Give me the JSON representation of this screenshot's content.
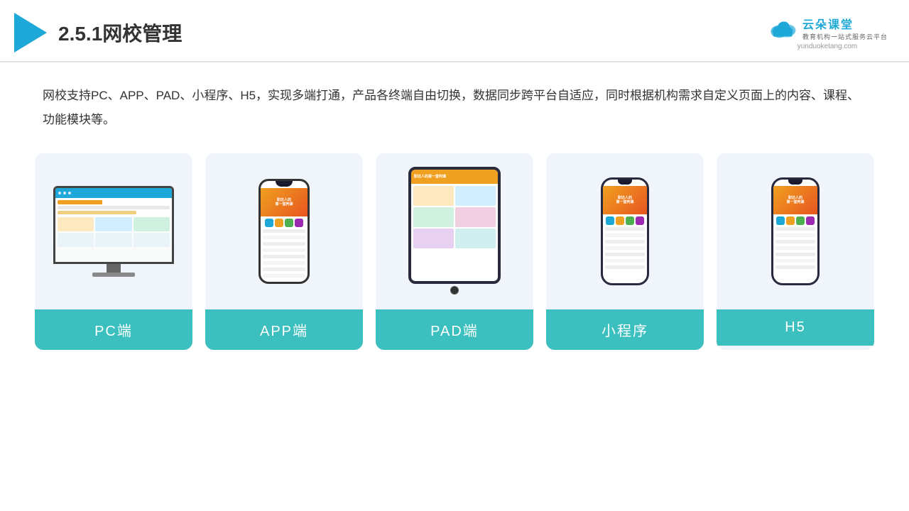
{
  "header": {
    "title": "2.5.1网校管理",
    "brand": {
      "name": "云朵课堂",
      "url": "yunduoketang.com",
      "tagline": "教育机构一站式服务云平台"
    }
  },
  "description": "网校支持PC、APP、PAD、小程序、H5，实现多端打通，产品各终端自由切换，数据同步跨平台自适应，同时根据机构需求自定义页面上的内容、课程、功能模块等。",
  "cards": [
    {
      "id": "pc",
      "label": "PC端"
    },
    {
      "id": "app",
      "label": "APP端"
    },
    {
      "id": "pad",
      "label": "PAD端"
    },
    {
      "id": "miniprogram",
      "label": "小程序"
    },
    {
      "id": "h5",
      "label": "H5"
    }
  ],
  "colors": {
    "teal": "#3bbfbf",
    "blue": "#1da8d8",
    "accent": "#f0a020"
  }
}
